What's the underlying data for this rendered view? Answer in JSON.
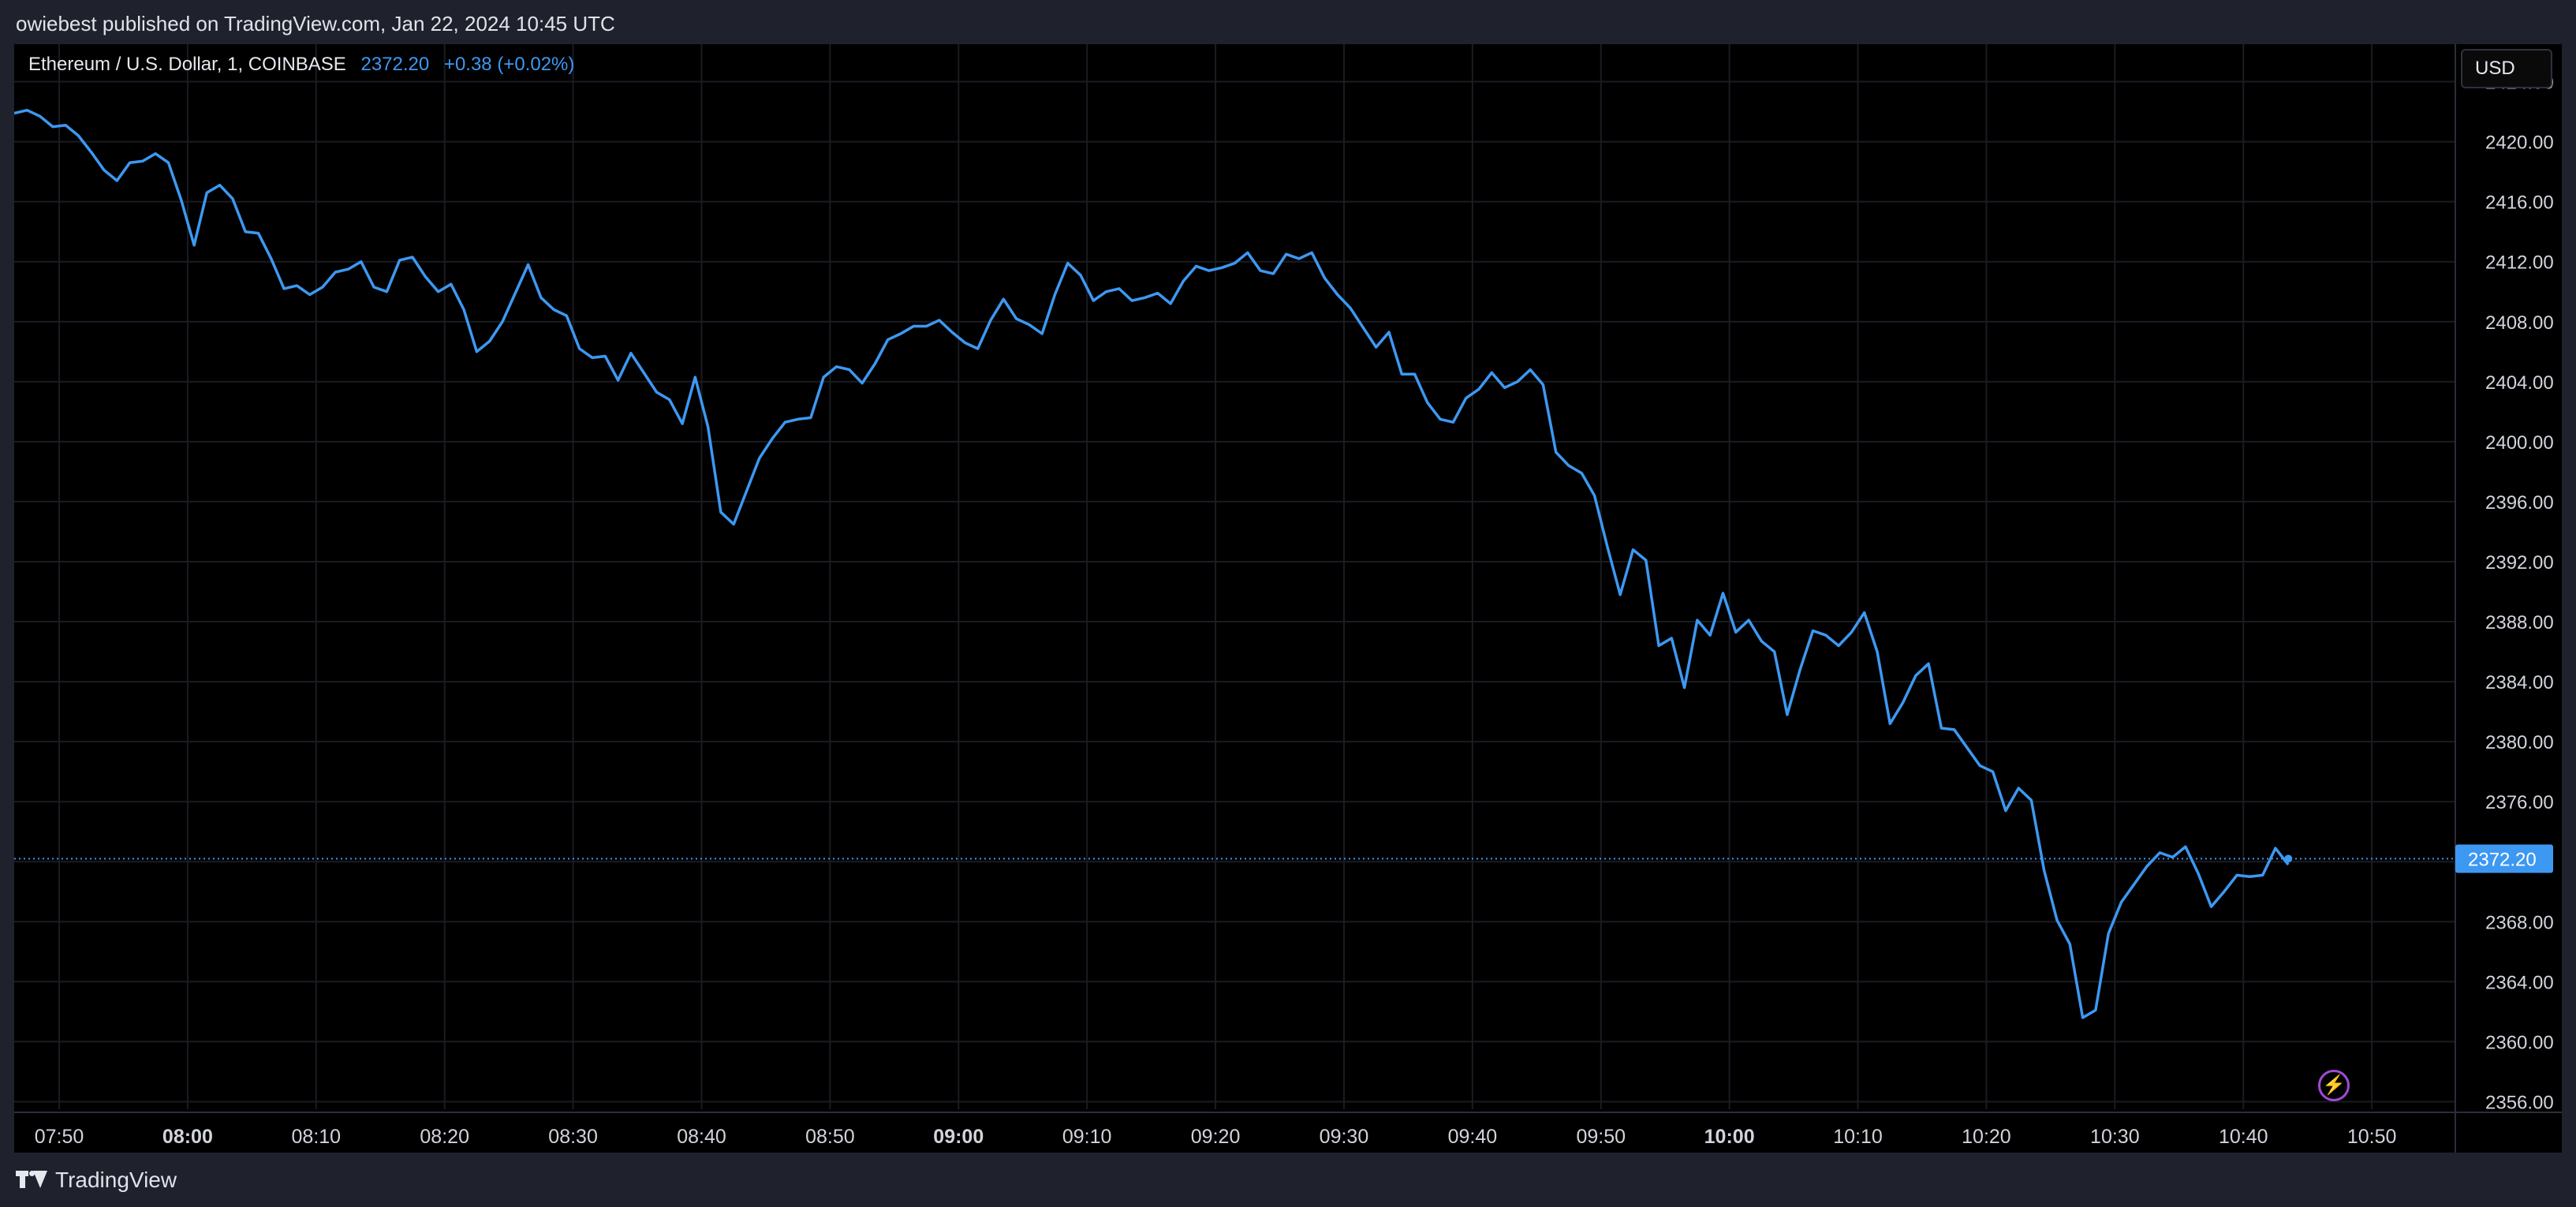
{
  "header": {
    "publish_line": "owiebest published on TradingView.com, Jan 22, 2024 10:45 UTC"
  },
  "legend": {
    "symbol": "Ethereum / U.S. Dollar, 1, COINBASE",
    "price": "2372.20",
    "change": "+0.38 (+0.02%)"
  },
  "currency_button": "USD",
  "footer": {
    "brand": "TradingView",
    "logo_icon": "tradingview-logo-icon"
  },
  "alert_icon": "lightning-icon",
  "colors": {
    "line": "#3d98f2",
    "background": "#000000",
    "price_label_bg": "#3d98f2",
    "grid": "#1a1c22"
  },
  "chart_data": {
    "type": "line",
    "symbol": "ETHUSD",
    "interval": "1",
    "exchange": "COINBASE",
    "last_price": 2372.2,
    "last_price_label": "2372.20",
    "ylim": [
      2355.5,
      2426.5
    ],
    "y_ticks": [
      "2356.00",
      "2360.00",
      "2364.00",
      "2368.00",
      "2372.00",
      "2376.00",
      "2380.00",
      "2384.00",
      "2388.00",
      "2392.00",
      "2396.00",
      "2400.00",
      "2404.00",
      "2408.00",
      "2412.00",
      "2416.00",
      "2420.00",
      "2424.00"
    ],
    "x_ticks": [
      {
        "label": "07:50",
        "t": 46.5,
        "bold": false
      },
      {
        "label": "08:00",
        "t": 56.5,
        "bold": true
      },
      {
        "label": "08:10",
        "t": 66.5,
        "bold": false
      },
      {
        "label": "08:20",
        "t": 76.5,
        "bold": false
      },
      {
        "label": "08:30",
        "t": 86.5,
        "bold": false
      },
      {
        "label": "08:40",
        "t": 96.5,
        "bold": false
      },
      {
        "label": "08:50",
        "t": 106.5,
        "bold": false
      },
      {
        "label": "09:00",
        "t": 116.5,
        "bold": true
      },
      {
        "label": "09:10",
        "t": 126.5,
        "bold": false
      },
      {
        "label": "09:20",
        "t": 136.5,
        "bold": false
      },
      {
        "label": "09:30",
        "t": 146.5,
        "bold": false
      },
      {
        "label": "09:40",
        "t": 156.5,
        "bold": false
      },
      {
        "label": "09:50",
        "t": 166.5,
        "bold": false
      },
      {
        "label": "10:00",
        "t": 176.5,
        "bold": true
      },
      {
        "label": "10:10",
        "t": 186.5,
        "bold": false
      },
      {
        "label": "10:20",
        "t": 196.5,
        "bold": false
      },
      {
        "label": "10:30",
        "t": 206.5,
        "bold": false
      },
      {
        "label": "10:40",
        "t": 216.5,
        "bold": false
      },
      {
        "label": "10:50",
        "t": 226.5,
        "bold": false
      }
    ],
    "x_range": [
      43.0,
      233.0
    ],
    "x": [
      43,
      44,
      45,
      46,
      47,
      48,
      49,
      50,
      51,
      52,
      53,
      54,
      55,
      56,
      57,
      58,
      59,
      60,
      61,
      62,
      63,
      64,
      65,
      66,
      67,
      68,
      69,
      70,
      71,
      72,
      73,
      74,
      75,
      76,
      77,
      78,
      79,
      80,
      81,
      82,
      83,
      84,
      85,
      86,
      87,
      88,
      89,
      90,
      91,
      92,
      93,
      94,
      95,
      96,
      97,
      98,
      99,
      100,
      101,
      102,
      103,
      104,
      105,
      106,
      107,
      108,
      109,
      110,
      111,
      112,
      113,
      114,
      115,
      116,
      117,
      118,
      119,
      120,
      121,
      122,
      123,
      124,
      125,
      126,
      127,
      128,
      129,
      130,
      131,
      132,
      133,
      134,
      135,
      136,
      137,
      138,
      139,
      140,
      141,
      142,
      143,
      144,
      145,
      146,
      147,
      148,
      149,
      150,
      151,
      152,
      153,
      154,
      155,
      156,
      157,
      158,
      159,
      160,
      161,
      162,
      163,
      164,
      165,
      166,
      167,
      168,
      169,
      170,
      171,
      172,
      173,
      174,
      175,
      176,
      177,
      178,
      179,
      180,
      181,
      182,
      183,
      184,
      185,
      186,
      187,
      188,
      189,
      190,
      191,
      192,
      193,
      194,
      195,
      196,
      197,
      198,
      199,
      200,
      201,
      202,
      203,
      204,
      205,
      206,
      207,
      208,
      209,
      210,
      211,
      212,
      213,
      214,
      215,
      216,
      217,
      218,
      219,
      220
    ],
    "y": [
      2421.9,
      2422.1,
      2421.7,
      2421.0,
      2421.1,
      2420.4,
      2419.3,
      2418.1,
      2417.4,
      2418.6,
      2418.7,
      2419.2,
      2418.6,
      2416.1,
      2413.1,
      2416.6,
      2417.1,
      2416.2,
      2414.0,
      2413.9,
      2412.2,
      2410.2,
      2410.4,
      2409.8,
      2410.3,
      2411.3,
      2411.5,
      2412.0,
      2410.3,
      2410.0,
      2412.1,
      2412.3,
      2411.0,
      2410.0,
      2410.5,
      2408.8,
      2406.0,
      2406.7,
      2408.0,
      2409.9,
      2411.8,
      2409.6,
      2408.8,
      2408.4,
      2406.2,
      2405.6,
      2405.7,
      2404.1,
      2405.9,
      2404.6,
      2403.3,
      2402.8,
      2401.2,
      2404.3,
      2401.0,
      2395.3,
      2394.5,
      2396.7,
      2398.9,
      2400.2,
      2401.3,
      2401.5,
      2401.6,
      2404.3,
      2405.0,
      2404.8,
      2403.9,
      2405.2,
      2406.8,
      2407.2,
      2407.7,
      2407.7,
      2408.1,
      2407.3,
      2406.6,
      2406.2,
      2408.1,
      2409.5,
      2408.2,
      2407.8,
      2407.2,
      2409.8,
      2411.9,
      2411.1,
      2409.4,
      2410.0,
      2410.2,
      2409.4,
      2409.6,
      2409.9,
      2409.2,
      2410.7,
      2411.7,
      2411.4,
      2411.6,
      2411.9,
      2412.6,
      2411.4,
      2411.2,
      2412.5,
      2412.2,
      2412.6,
      2410.9,
      2409.8,
      2408.9,
      2407.6,
      2406.3,
      2407.3,
      2404.5,
      2404.5,
      2402.6,
      2401.5,
      2401.3,
      2402.9,
      2403.5,
      2404.6,
      2403.6,
      2404.0,
      2404.8,
      2403.8,
      2399.3,
      2398.4,
      2397.9,
      2396.4,
      2393.0,
      2389.8,
      2392.8,
      2392.1,
      2386.4,
      2386.9,
      2383.6,
      2388.1,
      2387.1,
      2389.9,
      2387.3,
      2388.1,
      2386.7,
      2386.0,
      2381.8,
      2384.8,
      2387.4,
      2387.1,
      2386.4,
      2387.3,
      2388.6,
      2386.0,
      2381.2,
      2382.6,
      2384.4,
      2385.2,
      2380.9,
      2380.8,
      2379.6,
      2378.4,
      2378.0,
      2375.4,
      2376.9,
      2376.1,
      2371.4,
      2368.1,
      2366.5,
      2361.6,
      2362.1,
      2367.2,
      2369.3,
      2370.5,
      2371.7,
      2372.6,
      2372.3,
      2373.0,
      2371.2,
      2369.0,
      2370.0,
      2371.1,
      2371.0,
      2371.1,
      2372.9,
      2371.8,
      2372.2
    ],
    "grid": true,
    "last_price_line": "dotted"
  }
}
